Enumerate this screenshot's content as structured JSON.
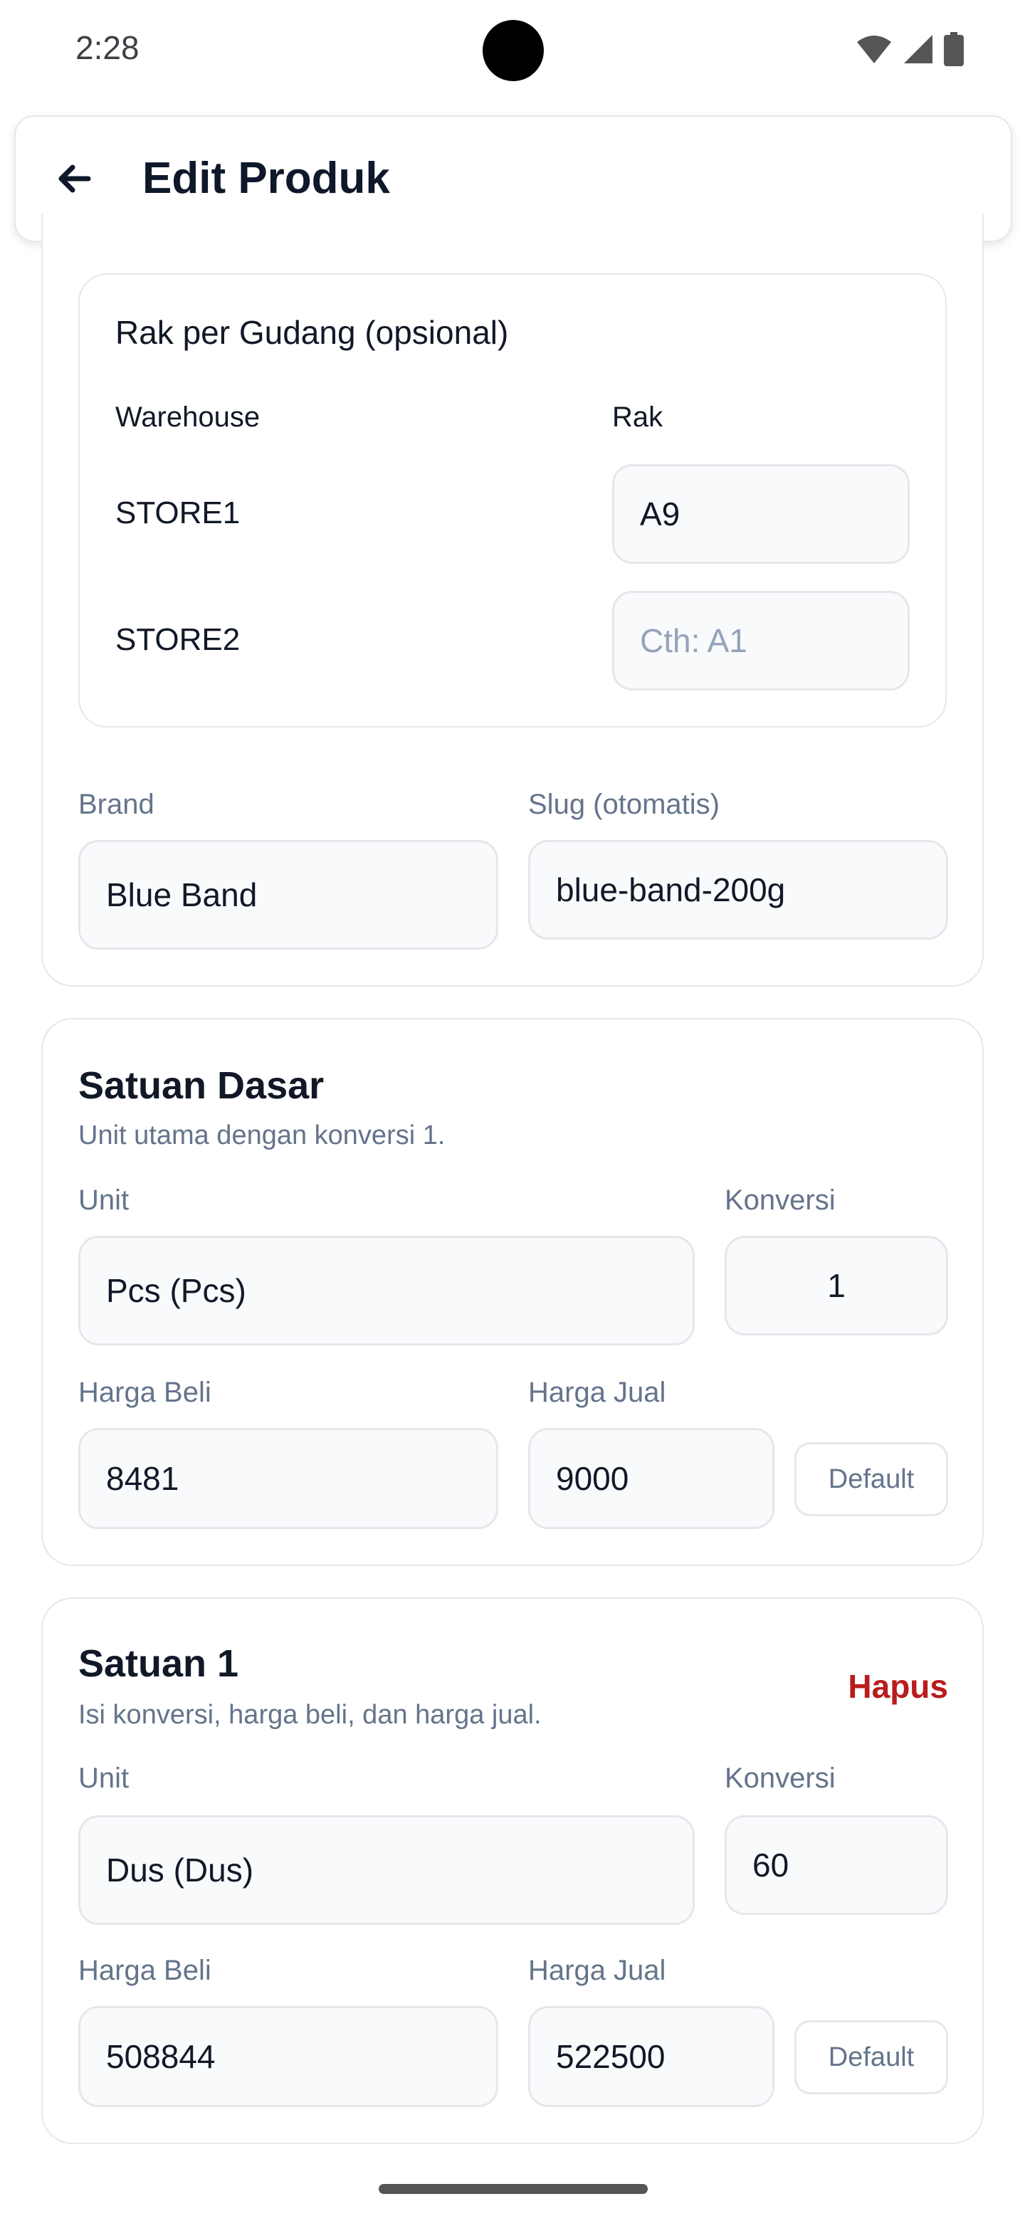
{
  "status_bar": {
    "time": "2:28"
  },
  "app_bar": {
    "title": "Edit Produk"
  },
  "rack_section": {
    "title": "Rak per Gudang (opsional)",
    "col_warehouse": "Warehouse",
    "col_rack": "Rak",
    "rows": [
      {
        "warehouse": "STORE1",
        "rack_value": "A9",
        "rack_placeholder": ""
      },
      {
        "warehouse": "STORE2",
        "rack_value": "",
        "rack_placeholder": "Cth: A1"
      }
    ]
  },
  "brand": {
    "label": "Brand",
    "value": "Blue Band"
  },
  "slug": {
    "label": "Slug (otomatis)",
    "value": "blue-band-200g"
  },
  "base_unit": {
    "title": "Satuan Dasar",
    "subtitle": "Unit utama dengan konversi 1.",
    "unit_label": "Unit",
    "unit_value": "Pcs (Pcs)",
    "conversion_label": "Konversi",
    "conversion_value": "1",
    "buy_label": "Harga Beli",
    "buy_value": "8481",
    "sell_label": "Harga Jual",
    "sell_value": "9000",
    "default_label": "Default"
  },
  "unit_1": {
    "title": "Satuan 1",
    "subtitle": "Isi konversi, harga beli, dan harga jual.",
    "delete_label": "Hapus",
    "unit_label": "Unit",
    "unit_value": "Dus (Dus)",
    "conversion_label": "Konversi",
    "conversion_value": "60",
    "buy_label": "Harga Beli",
    "buy_value": "508844",
    "sell_label": "Harga Jual",
    "sell_value": "522500",
    "default_label": "Default"
  },
  "icons": {
    "back": "arrow-left-icon",
    "wifi": "wifi-icon",
    "signal": "signal-icon",
    "battery": "battery-icon"
  },
  "colors": {
    "danger": "#b91c1c",
    "border": "#e5e7eb",
    "muted_text": "#64748b",
    "field_bg": "#f8fafc"
  }
}
